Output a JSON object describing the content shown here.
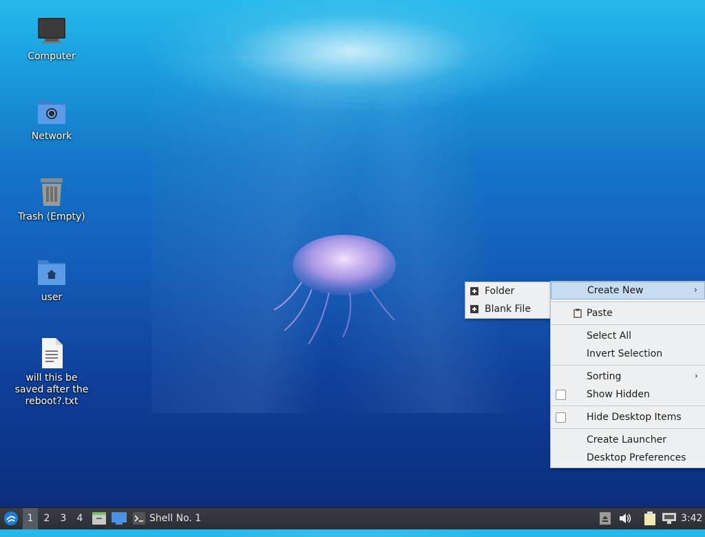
{
  "desktop": {
    "icons": [
      {
        "label": "Computer",
        "icon": "computer-icon"
      },
      {
        "label": "Network",
        "icon": "network-folder-icon"
      },
      {
        "label": "Trash (Empty)",
        "icon": "trash-icon"
      },
      {
        "label": "user",
        "icon": "home-folder-icon"
      },
      {
        "label": "will this be saved after the reboot?.txt",
        "icon": "text-file-icon"
      }
    ]
  },
  "context_menu": {
    "create_new": "Create New",
    "paste": "Paste",
    "select_all": "Select All",
    "invert_selection": "Invert Selection",
    "sorting": "Sorting",
    "show_hidden": "Show Hidden",
    "hide_desktop_items": "Hide Desktop Items",
    "create_launcher": "Create Launcher",
    "desktop_preferences": "Desktop Preferences",
    "show_hidden_checked": false,
    "hide_desktop_items_checked": false
  },
  "submenu": {
    "folder": "Folder",
    "blank_file": "Blank File"
  },
  "taskbar": {
    "workspaces": [
      "1",
      "2",
      "3",
      "4"
    ],
    "active_workspace": "1",
    "task_label": "Shell No. 1",
    "clock": "3:42"
  },
  "colors": {
    "menu_bg": "#eff0f1",
    "menu_highlight": "#c6dcf1",
    "panel_bg": "#2b2e35"
  }
}
